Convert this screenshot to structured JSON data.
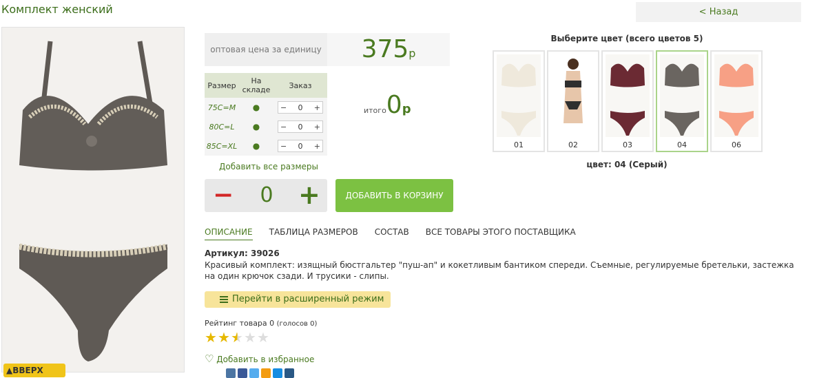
{
  "title": "Комплект женский",
  "back_label": "< Назад",
  "up_button": "▲ВВЕРХ",
  "price": {
    "label": "оптовая цена за единицу",
    "value": "375",
    "currency": "р"
  },
  "sizes_table": {
    "headers": [
      "Размер",
      "На складе",
      "Заказ"
    ],
    "rows": [
      {
        "size": "75C=M",
        "stock": "●",
        "qty": "0"
      },
      {
        "size": "80C=L",
        "stock": "●",
        "qty": "0"
      },
      {
        "size": "85C=XL",
        "stock": "●",
        "qty": "0"
      }
    ],
    "minus": "−",
    "plus": "+"
  },
  "total": {
    "label": "итого",
    "value": "0",
    "currency": "р"
  },
  "add_all_sizes": "Добавить все размеры",
  "quantity": {
    "minus": "−",
    "value": "0",
    "plus": "+"
  },
  "add_to_cart": "ДОБАВИТЬ В КОРЗИНУ",
  "tabs": [
    "ОПИСАНИЕ",
    "ТАБЛИЦА РАЗМЕРОВ",
    "СОСТАВ",
    "ВСЕ ТОВАРЫ ЭТОГО ПОСТАВЩИКА"
  ],
  "articul": "Артикул: 39026",
  "description": "Красивый комплект: изящный бюстгальтер \"пуш-ап\" и кокетливым бантиком спереди. Съемные, регулируемые бретельки, застежка на один крючок сзади. И трусики - слипы.",
  "extended_mode": "Перейти в расширенный режим",
  "rating": {
    "label": "Рейтинг товара 0",
    "votes": "(голосов 0)",
    "stars": 2.5,
    "max": 5
  },
  "favorite": "Добавить в избранное",
  "colors": {
    "heading": "Выберите цвет (всего цветов 5)",
    "items": [
      {
        "label": "01",
        "color": "#efe9dc"
      },
      {
        "label": "02",
        "color": "#2f2f2f"
      },
      {
        "label": "03",
        "color": "#6b2a33"
      },
      {
        "label": "04",
        "color": "#6a6560"
      },
      {
        "label": "06",
        "color": "#f7a085"
      }
    ],
    "selected_text": "цвет: 04 (Серый)"
  },
  "social_colors": [
    "#4c75a3",
    "#3b5998",
    "#55acee",
    "#f39c12",
    "#168de2",
    "#2a5885"
  ]
}
